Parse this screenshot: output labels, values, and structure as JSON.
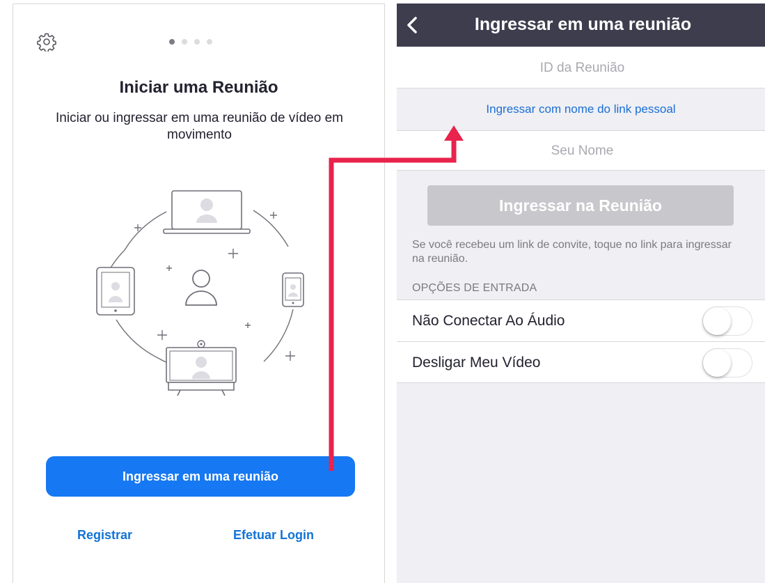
{
  "left": {
    "title": "Iniciar uma Reunião",
    "subtitle": "Iniciar ou ingressar em uma reunião de vídeo em movimento",
    "join_button": "Ingressar em uma reunião",
    "register_link": "Registrar",
    "login_link": "Efetuar Login",
    "page_indicator": {
      "count": 4,
      "active": 0
    },
    "icons": [
      "gear-icon",
      "laptop-icon",
      "tablet-icon",
      "phone-icon",
      "person-icon",
      "room-display-icon"
    ]
  },
  "right": {
    "nav_title": "Ingressar em uma reunião",
    "meeting_id_placeholder": "ID da Reunião",
    "personal_link": "Ingressar com nome do link pessoal",
    "name_placeholder": "Seu Nome",
    "join_button": "Ingressar na Reunião",
    "invite_hint": "Se você recebeu um link de convite, toque no link para ingressar na reunião.",
    "options_header": "OPÇÕES DE ENTRADA",
    "options": [
      {
        "label": "Não Conectar Ao Áudio",
        "enabled": false
      },
      {
        "label": "Desligar Meu Vídeo",
        "enabled": false
      }
    ]
  },
  "colors": {
    "primary_blue": "#1678f2",
    "link_blue": "#1a6fd6",
    "nav_bar": "#3d3d4e",
    "arrow": "#e8234c",
    "disabled_button": "#c8c8cc"
  }
}
